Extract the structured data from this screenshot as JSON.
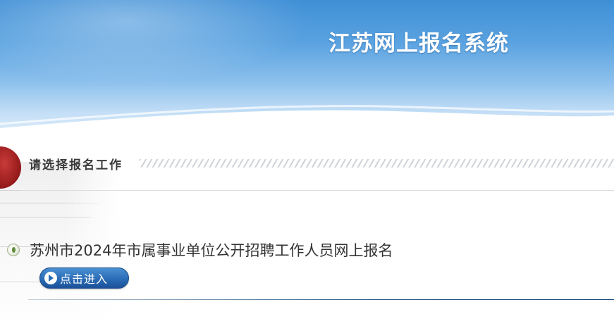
{
  "banner": {
    "title": "江苏网上报名系统"
  },
  "section": {
    "title": "请选择报名工作"
  },
  "jobs": [
    {
      "title": "苏州市2024年市属事业单位公开招聘工作人员网上报名",
      "enter_label": "点击进入"
    }
  ],
  "colors": {
    "banner_blue": "#3f8fd6",
    "button_blue": "#2a6cb6",
    "accent_red": "#9a1d1d"
  },
  "icons": {
    "job_bullet": "leaf-bullet-icon",
    "enter_arrow": "play-arrow-icon"
  }
}
